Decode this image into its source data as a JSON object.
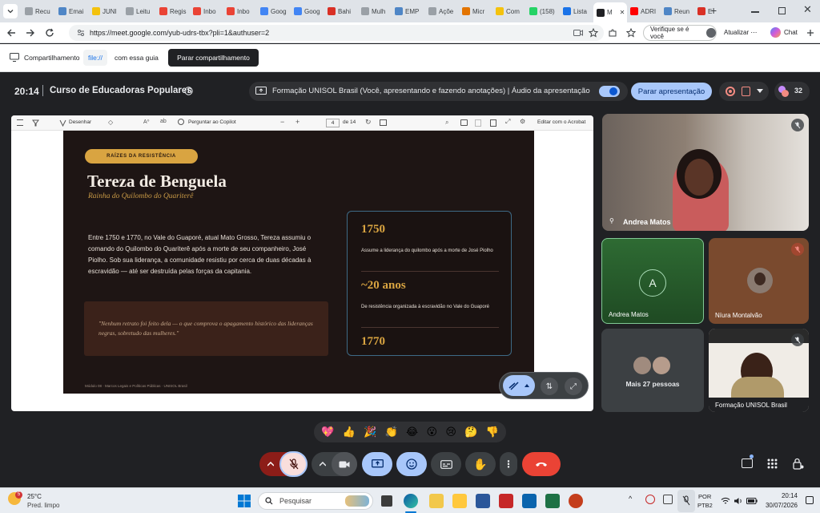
{
  "browser": {
    "tabs": [
      {
        "label": "Recu",
        "color": "#9aa0a6"
      },
      {
        "label": "Emai",
        "color": "#4f86c6"
      },
      {
        "label": "JUNI",
        "color": "#f4c20d"
      },
      {
        "label": "Leitu",
        "color": "#9aa0a6"
      },
      {
        "label": "Regis",
        "color": "#ea4335"
      },
      {
        "label": "Inbo",
        "color": "#ea4335"
      },
      {
        "label": "Inbo",
        "color": "#ea4335"
      },
      {
        "label": "Goog",
        "color": "#4285f4"
      },
      {
        "label": "Goog",
        "color": "#4285f4"
      },
      {
        "label": "Bahi",
        "color": "#d93025"
      },
      {
        "label": "Mulh",
        "color": "#9aa0a6"
      },
      {
        "label": "EMP",
        "color": "#4f86c6"
      },
      {
        "label": "Açõe",
        "color": "#9aa0a6"
      },
      {
        "label": "Micr",
        "color": "#e37400"
      },
      {
        "label": "Com",
        "color": "#f4c20d"
      },
      {
        "label": "(158)",
        "color": "#25d366"
      },
      {
        "label": "Lista",
        "color": "#1a73e8"
      },
      {
        "label": "M",
        "color": "#202124"
      },
      {
        "label": "ADRI",
        "color": "#ff0000"
      },
      {
        "label": "Reun",
        "color": "#4f86c6"
      },
      {
        "label": "E",
        "color": "#d93025"
      }
    ],
    "url": "https://meet.google.com/yub-udrs-tbx?pli=1&authuser=2",
    "verify_label": "Verifique se é você",
    "update_label": "Atualizar",
    "chat_label": "Chat"
  },
  "sharebar": {
    "label": "Compartilhamento",
    "source": "file://",
    "suffix": "com essa guia",
    "stop_label": "Parar compartilhamento"
  },
  "meet": {
    "time": "20:14",
    "meeting_title": "Curso de Educadoras Populares",
    "presenting_label": "Formação UNISOL Brasil (Você, apresentando e fazendo anotações)",
    "audio_label": "Áudio da apresentação",
    "stop_presenting_label": "Parar apresentação",
    "participants_count": "32",
    "colors": {
      "accent": "#a8c7fa",
      "end_call": "#ea4335",
      "bg": "#202124"
    }
  },
  "pdf_toolbar": {
    "draw_label": "Desenhar",
    "copilot_label": "Perguntar ao Copilot",
    "page_current": "4",
    "page_total": "de 14",
    "acrobat_label": "Editar com o Acrobat"
  },
  "slide": {
    "badge": "RAÍZES DA RESISTÊNCIA",
    "title": "Tereza de Benguela",
    "subtitle": "Rainha do Quilombo do Quariterê",
    "body": "Entre 1750 e 1770, no Vale do Guaporé, atual Mato Grosso, Tereza assumiu o comando do Quilombo do Quariterê após a morte de seu companheiro, José Piolho. Sob sua liderança, a comunidade resistiu por cerca de duas décadas à escravidão — até ser destruída pelas forças da capitania.",
    "quote": "\"Nenhum retrato foi feito dela — o que comprova o apagamento histórico das lideranças negras, sobretudo das mulheres.\"",
    "stats": [
      {
        "value": "1750",
        "desc": "Assume a liderança do quilombo após a morte de José Piolho"
      },
      {
        "value": "~20 anos",
        "desc": "De resistência organizada à escravidão no Vale do Guaporé"
      },
      {
        "value": "1770",
        "desc": ""
      }
    ],
    "footer": "Módulo 08 · Marcos Legais e Políticas Públicas · UNISOL Brasil",
    "colors": {
      "gold": "#d9a441",
      "bg": "#1e1514"
    }
  },
  "participants": {
    "main": "Andrea Matos",
    "tile1_initial": "A",
    "tile1_name": "Andrea Matos",
    "tile2_name": "Níura Montalvão",
    "more_label": "Mais 27 pessoas",
    "tile4_name": "Formação UNISOL Brasil"
  },
  "reactions": [
    "💖",
    "👍",
    "🎉",
    "👏",
    "😂",
    "😮",
    "😢",
    "🤔",
    "👎"
  ],
  "taskbar": {
    "weather_temp": "25°C",
    "weather_desc": "Pred. limpo",
    "weather_badge": "5",
    "search_placeholder": "Pesquisar",
    "lang1": "POR",
    "lang2": "PTB2",
    "clock_time": "20:14",
    "clock_date": "30/07/2026"
  }
}
